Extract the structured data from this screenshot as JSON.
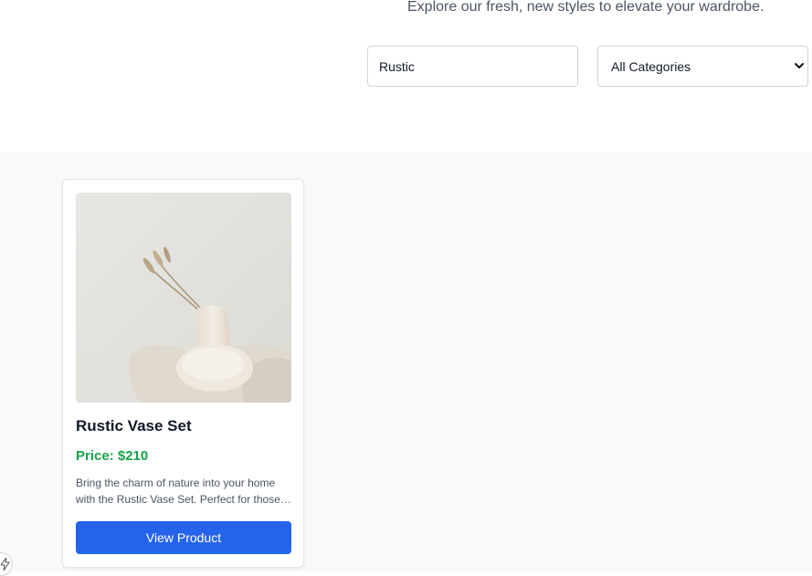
{
  "header": {
    "subtitle": "Explore our fresh, new styles to elevate your wardrobe."
  },
  "filters": {
    "search_value": "Rustic",
    "category_selected": "All Categories"
  },
  "products": [
    {
      "title": "Rustic Vase Set",
      "price": "Price: $210",
      "description": "Bring the charm of nature into your home with the Rustic Vase Set. Perfect for those who love natural decor.",
      "button_label": "View Product"
    }
  ],
  "colors": {
    "accent": "#2563eb",
    "price": "#16a34a",
    "background": "#f8f9fb"
  },
  "icons": {
    "select": "chevron-down-icon",
    "corner": "lightning-icon"
  }
}
